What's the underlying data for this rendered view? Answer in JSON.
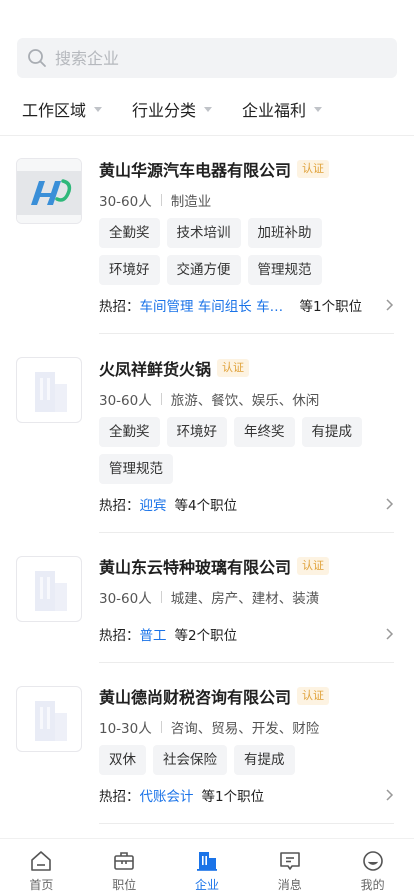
{
  "search": {
    "placeholder": "搜索企业"
  },
  "filters": [
    {
      "label": "工作区域"
    },
    {
      "label": "行业分类"
    },
    {
      "label": "企业福利"
    }
  ],
  "companies": [
    {
      "name": "黄山华源汽车电器有限公司",
      "badge": "认证",
      "size": "30-60人",
      "industry": "制造业",
      "tags": [
        "全勤奖",
        "技术培训",
        "加班补助",
        "环境好",
        "交通方便",
        "管理规范"
      ],
      "hot_label": "热招：",
      "hot_jobs": "车间管理 车间组长 车间...",
      "hot_count": "等1个职位",
      "logo": "hy-logo"
    },
    {
      "name": "火凤祥鲜货火锅",
      "badge": "认证",
      "size": "30-60人",
      "industry": "旅游、餐饮、娱乐、休闲",
      "tags": [
        "全勤奖",
        "环境好",
        "年终奖",
        "有提成",
        "管理规范"
      ],
      "hot_label": "热招：",
      "hot_jobs": "迎宾",
      "hot_count": "等4个职位",
      "logo": "building-placeholder-icon"
    },
    {
      "name": "黄山东云特种玻璃有限公司",
      "badge": "认证",
      "size": "30-60人",
      "industry": "城建、房产、建材、装潢",
      "tags": [],
      "hot_label": "热招：",
      "hot_jobs": "普工",
      "hot_count": "等2个职位",
      "logo": "building-placeholder-icon"
    },
    {
      "name": "黄山德尚财税咨询有限公司",
      "badge": "认证",
      "size": "10-30人",
      "industry": "咨询、贸易、开发、财险",
      "tags": [
        "双休",
        "社会保险",
        "有提成"
      ],
      "hot_label": "热招：",
      "hot_jobs": "代账会计",
      "hot_count": "等1个职位",
      "logo": "building-placeholder-icon"
    }
  ],
  "tabbar": {
    "active": "企业",
    "accent_color": "#1a73e8",
    "tabs": [
      {
        "label": "首页",
        "icon": "home-icon"
      },
      {
        "label": "职位",
        "icon": "briefcase-icon"
      },
      {
        "label": "企业",
        "icon": "company-icon"
      },
      {
        "label": "消息",
        "icon": "message-icon"
      },
      {
        "label": "我的",
        "icon": "profile-icon"
      }
    ]
  }
}
